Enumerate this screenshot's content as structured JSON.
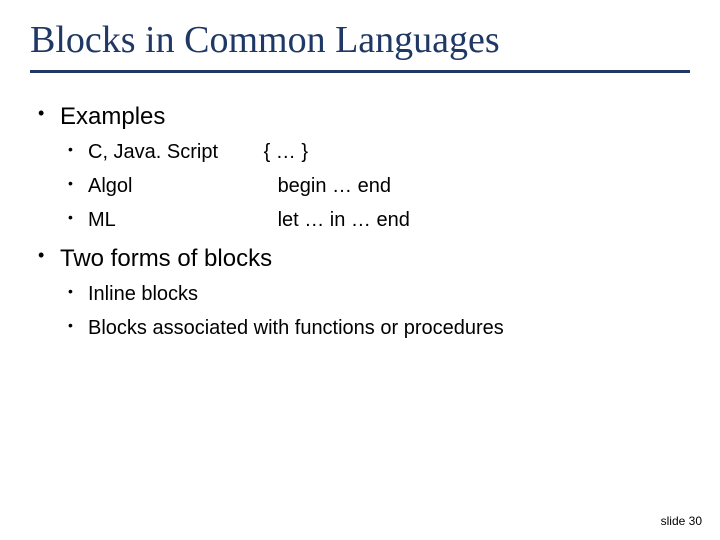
{
  "title": "Blocks in Common Languages",
  "bullets": {
    "examples": {
      "label": "Examples",
      "items": [
        {
          "lang": "C, Java. Script",
          "syntax": "{ … }"
        },
        {
          "lang": "Algol",
          "syntax": "begin … end"
        },
        {
          "lang": "ML",
          "syntax": "let … in … end"
        }
      ]
    },
    "forms": {
      "label": "Two forms of blocks",
      "items": [
        {
          "text": "Inline blocks"
        },
        {
          "text": "Blocks associated with functions or procedures"
        }
      ]
    }
  },
  "footer": "slide 30"
}
